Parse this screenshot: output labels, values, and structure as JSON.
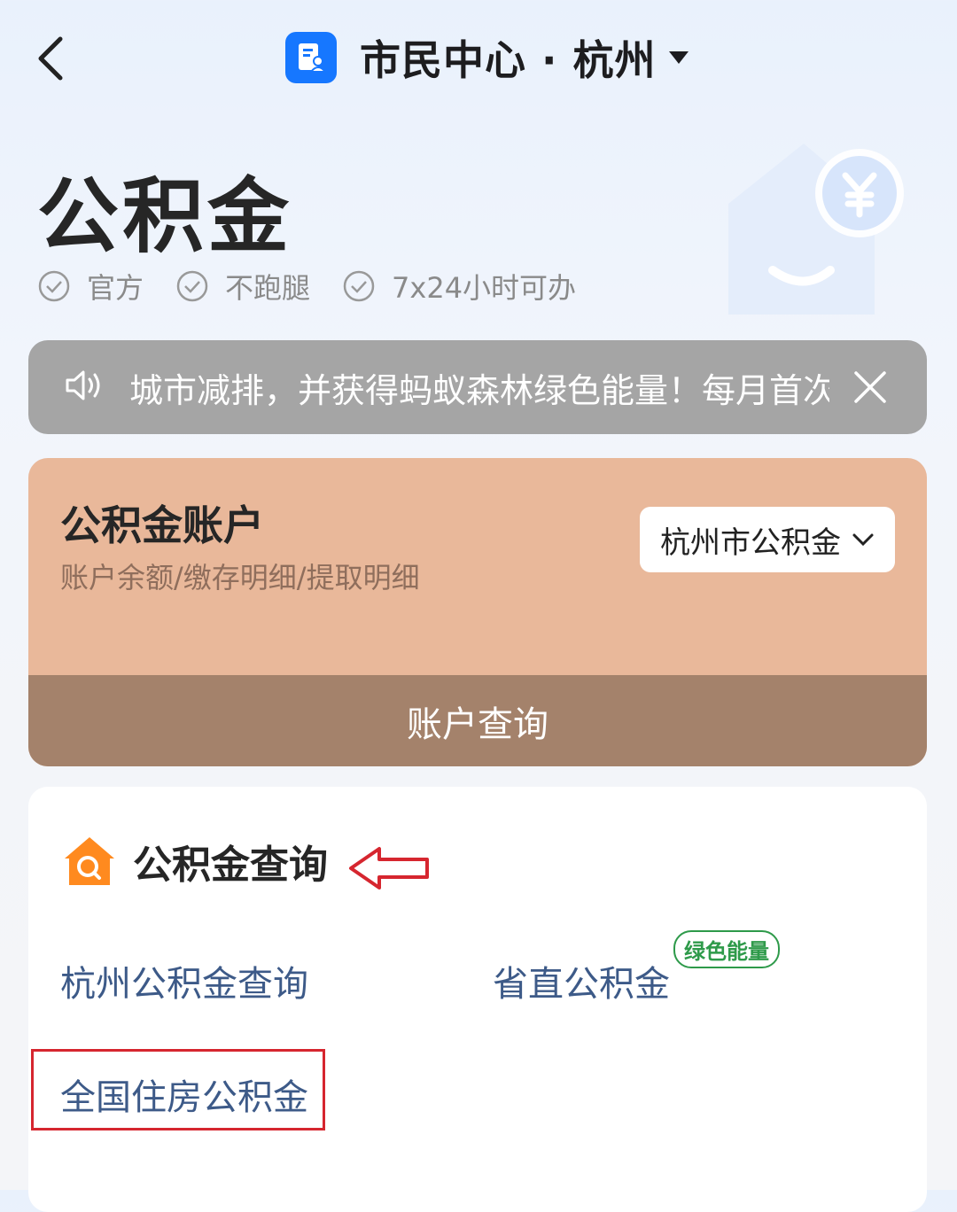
{
  "header": {
    "title": "市民中心 · 杭州"
  },
  "hero": {
    "title": "公积金",
    "tags": [
      "官方",
      "不跑腿",
      "7x24小时可办"
    ]
  },
  "notice": {
    "text": "城市减排，并获得蚂蚁森林绿色能量！每月首次"
  },
  "account": {
    "title": "公积金账户",
    "subtitle": "账户余额/缴存明细/提取明细",
    "selector": "杭州市公积金",
    "button": "账户查询"
  },
  "query": {
    "title": "公积金查询",
    "items": [
      {
        "label": "杭州公积金查询"
      },
      {
        "label": "省直公积金",
        "badge": "绿色能量"
      },
      {
        "label": "全国住房公积金"
      }
    ]
  },
  "colors": {
    "accent": "#1677ff",
    "card": "#e9b89a",
    "button": "#a4826b",
    "link": "#3d5a88",
    "badge": "#2e9a4a",
    "highlight": "#d6262f"
  }
}
